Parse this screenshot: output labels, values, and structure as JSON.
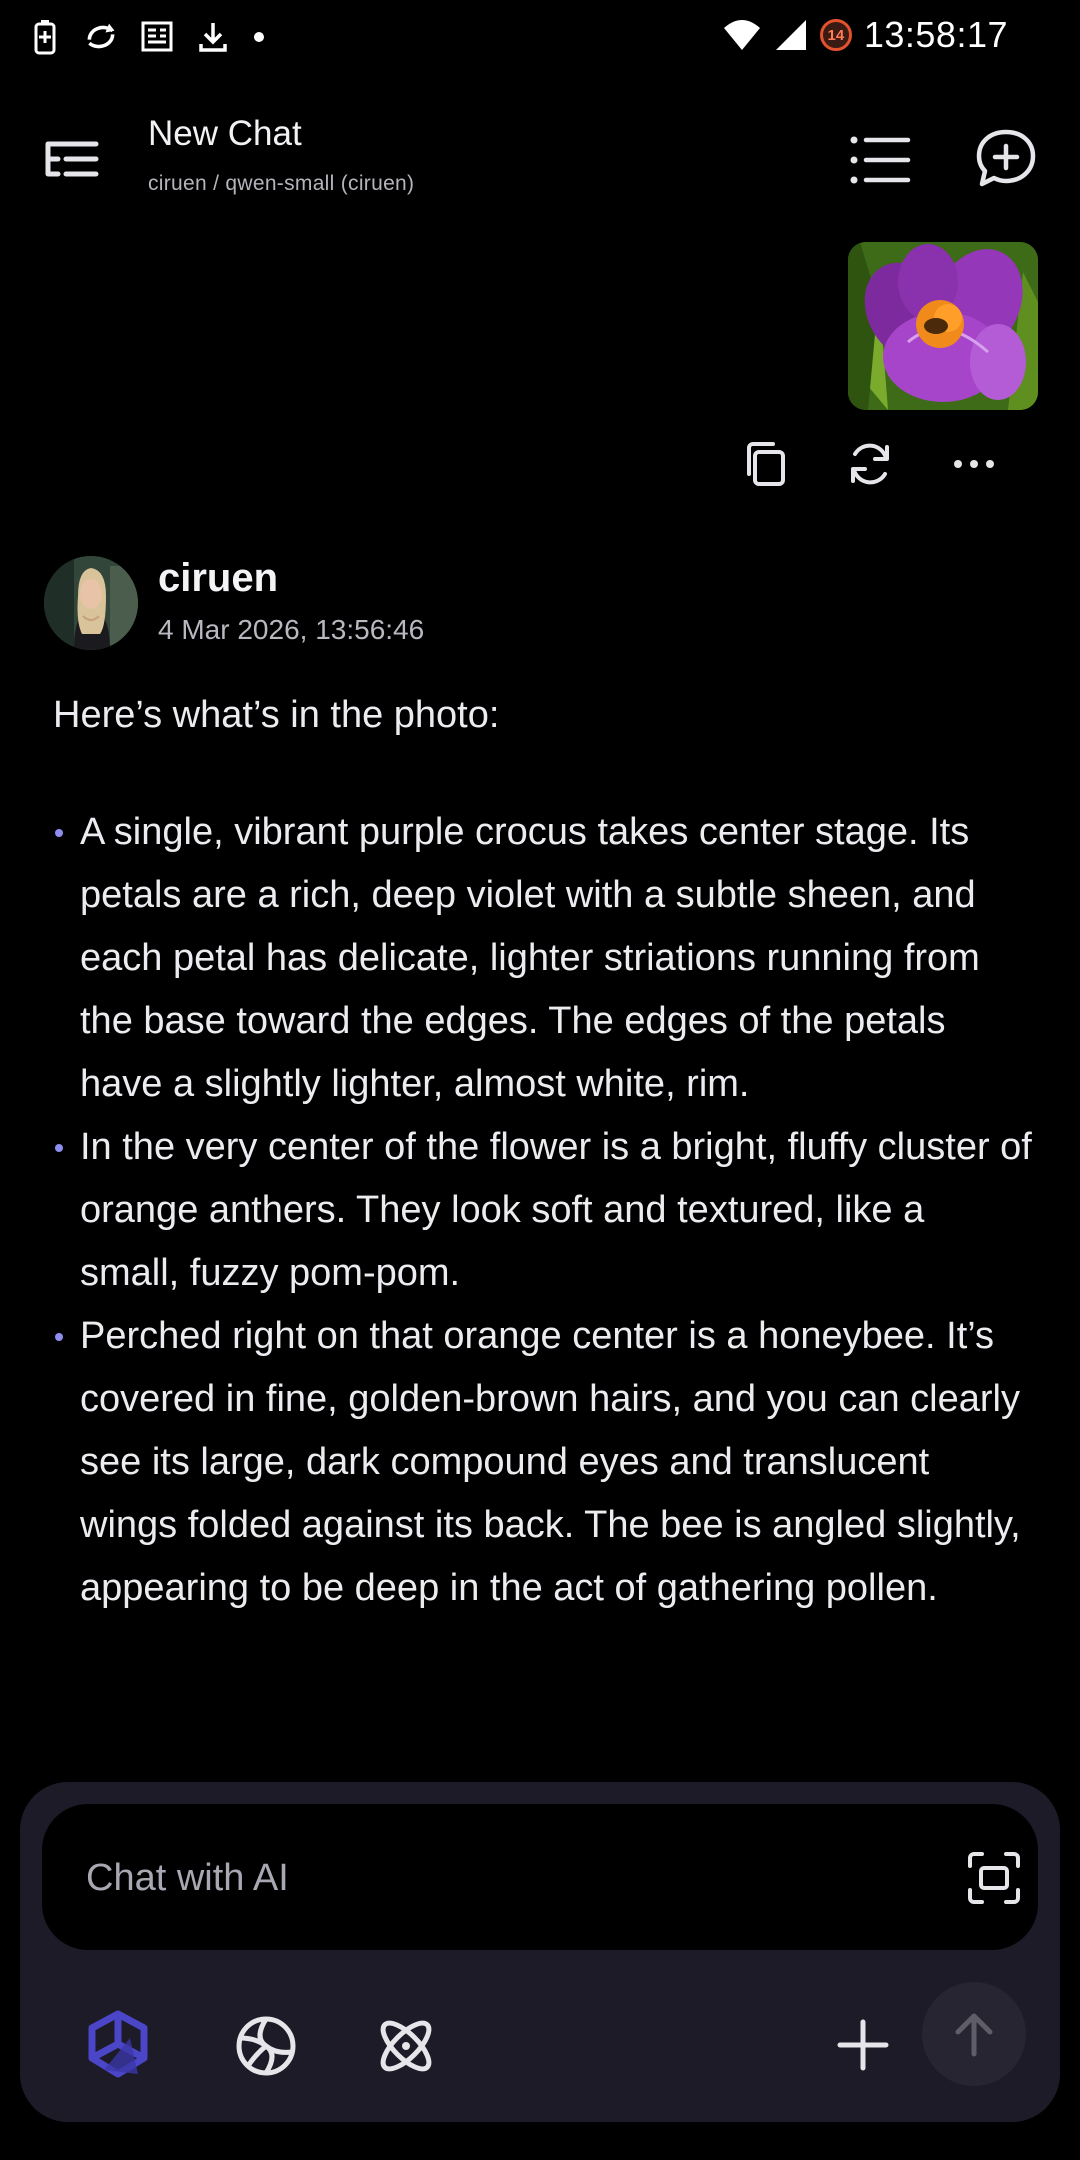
{
  "status_bar": {
    "time": "13:58:17",
    "notification_count": "14",
    "icons": [
      "battery-saver-icon",
      "sync-icon",
      "news-icon",
      "download-icon",
      "dot-icon",
      "wifi-icon",
      "signal-icon"
    ]
  },
  "header": {
    "title": "New Chat",
    "subtitle": "ciruen / qwen-small (ciruen)",
    "icons": [
      "sidebar-icon",
      "list-icon",
      "new-chat-icon"
    ]
  },
  "user_message": {
    "attachment": "purple-crocus-photo",
    "actions": [
      "copy-icon",
      "regenerate-icon",
      "more-icon"
    ]
  },
  "assistant": {
    "name": "ciruen",
    "timestamp": "4 Mar 2026, 13:56:46",
    "intro": "Here’s what’s in the photo:",
    "bullets": [
      "A single, vibrant purple crocus takes center stage. Its petals are a rich, deep violet with a subtle sheen, and each petal has delicate, lighter striations running from the base toward the edges. The edges of the petals have a slightly lighter, almost white, rim.",
      "In the very center of the flower is a bright, fluffy cluster of orange anthers. They look soft and textured, like a small, fuzzy pom-pom.",
      "Perched right on that orange center is a honeybee. It’s covered in fine, golden-brown hairs, and you can clearly see its large, dark compound eyes and translucent wings folded against its back. The bee is angled slightly, appearing to be deep in the act of gathering pollen."
    ]
  },
  "composer": {
    "placeholder": "Chat with AI",
    "tools": [
      "model-icon",
      "web-search-icon",
      "reasoning-icon",
      "add-icon",
      "send-icon"
    ]
  },
  "colors": {
    "background": "#000000",
    "composer": "#1c1b27",
    "accent": "#8e8ef0",
    "model_icon": "#4b46c8"
  }
}
